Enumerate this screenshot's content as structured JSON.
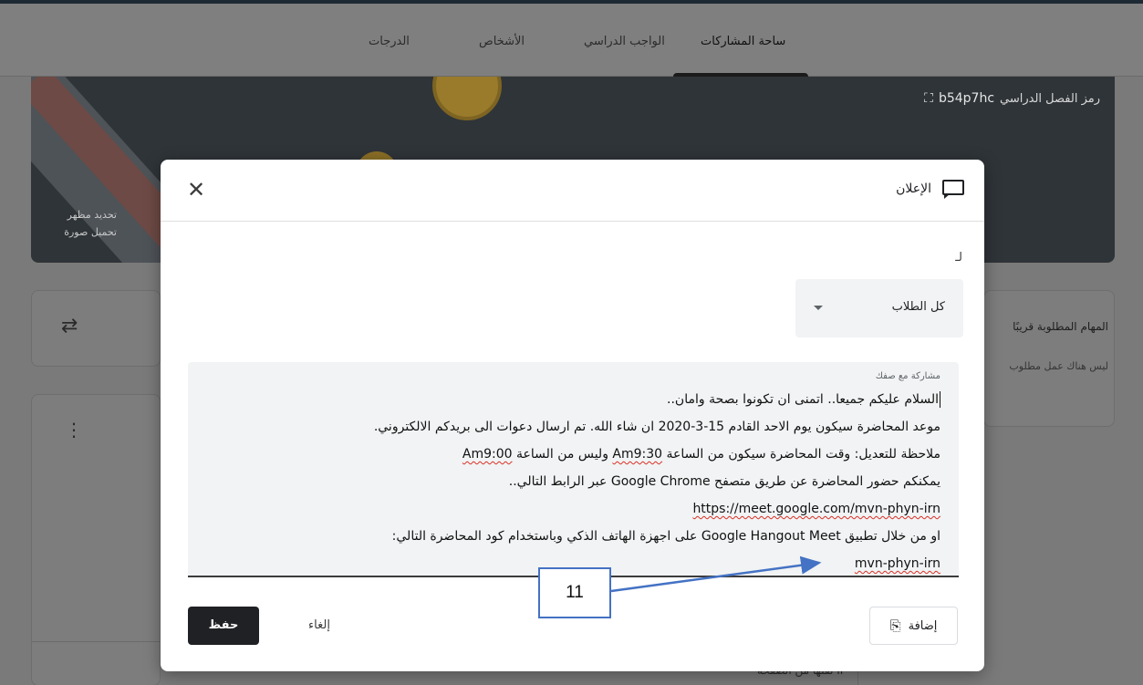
{
  "tabs": {
    "stream": "ساحة المشاركات",
    "classwork": "الواجب الدراسي",
    "people": "الأشخاص",
    "grades": "الدرجات"
  },
  "banner": {
    "class_code_label": "رمز الفصل الدراسي",
    "class_code": "b54p7hc",
    "expand_icon": "⛶",
    "select_theme": "تحديد مظهر",
    "upload_photo": "تحميل صورة"
  },
  "sidebar": {
    "upcoming_title": "المهام المطلوبة قريبًا",
    "upcoming_empty": "ليس هناك عمل مطلوب",
    "bottom_text": "II نقلها من الصفحة"
  },
  "modal": {
    "title": "الإعلان",
    "for_label": "لـ",
    "audience": "كل الطلاب",
    "textarea_label": "مشاركة مع صفك",
    "lines": [
      "السلام عليكم جميعا.. اتمنى ان تكونوا بصحة وامان..",
      "موعد المحاضرة سيكون يوم الاحد القادم 15-3-2020 ان شاء الله. تم ارسال دعوات الى بريدكم الالكتروني.",
      "ملاحظة للتعديل: وقت المحاضرة سيكون من الساعة",
      "Am9:30",
      "وليس من الساعة",
      "Am9:00",
      "يمكنكم حضور المحاضرة عن طريق متصفح Google Chrome عبر الرابط التالي..",
      "https://meet.google.com/mvn-phyn-irn",
      "او من خلال تطبيق Google Hangout Meet على اجهزة الهاتف الذكي وباستخدام كود المحاضرة التالي:",
      "mvn-phyn-irn"
    ],
    "add_label": "إضافة",
    "cancel_label": "إلغاء",
    "save_label": "حفظ"
  },
  "annotation": {
    "label": "11"
  }
}
